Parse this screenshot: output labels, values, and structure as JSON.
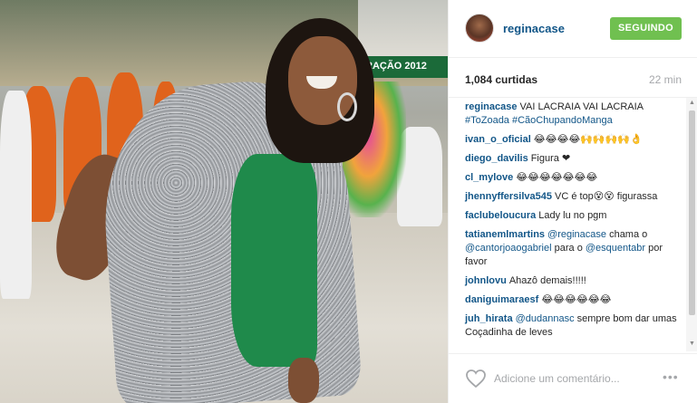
{
  "photo": {
    "sign_text": "RAÇÃO 2012"
  },
  "header": {
    "username": "reginacase",
    "follow_label": "SEGUINDO"
  },
  "stats": {
    "likes": "1,084 curtidas",
    "time": "22 min"
  },
  "comments": [
    {
      "user": "reginacase",
      "parts": [
        {
          "t": "VAI LACRAIA VAI LACRAIA "
        },
        {
          "t": "#ToZoada",
          "k": "tag"
        },
        {
          "t": " "
        },
        {
          "t": "#CãoChupandoManga",
          "k": "tag"
        }
      ]
    },
    {
      "user": "ivan_o_oficial",
      "parts": [
        {
          "t": "😂😂😂😂🙌🙌🙌🙌👌"
        }
      ]
    },
    {
      "user": "diego_davilis",
      "parts": [
        {
          "t": "Figura ❤"
        }
      ]
    },
    {
      "user": "cl_mylove",
      "parts": [
        {
          "t": "😂😂😂😂😂😂😂"
        }
      ]
    },
    {
      "user": "jhennyffersilva545",
      "parts": [
        {
          "t": "VC é top😵😵 figurassa"
        }
      ]
    },
    {
      "user": "faclubeloucura",
      "parts": [
        {
          "t": "Lady lu no pgm"
        }
      ]
    },
    {
      "user": "tatianemlmartins",
      "parts": [
        {
          "t": "@reginacase",
          "k": "mention"
        },
        {
          "t": " chama o "
        },
        {
          "t": "@cantorjoaogabriel",
          "k": "mention"
        },
        {
          "t": " para o "
        },
        {
          "t": "@esquentabr",
          "k": "mention"
        },
        {
          "t": " por favor"
        }
      ]
    },
    {
      "user": "johnlovu",
      "parts": [
        {
          "t": "Ahazô demais!!!!!"
        }
      ]
    },
    {
      "user": "daniguimaraesf",
      "parts": [
        {
          "t": "😂😂😂😂😂😂"
        }
      ]
    },
    {
      "user": "juh_hirata",
      "parts": [
        {
          "t": "@dudannasc",
          "k": "mention"
        },
        {
          "t": " sempre bom dar umas Coçadinha de leves"
        }
      ]
    }
  ],
  "footer": {
    "comment_placeholder": "Adicione um comentário...",
    "more_label": "•••"
  },
  "colors": {
    "username_blue": "#125688",
    "follow_green": "#70c050",
    "muted_gray": "#a5a7aa"
  },
  "icons": {
    "heart": "heart-outline-icon",
    "more": "ellipsis-icon",
    "scroll_up": "scroll-up-arrow-icon",
    "scroll_down": "scroll-down-arrow-icon"
  }
}
